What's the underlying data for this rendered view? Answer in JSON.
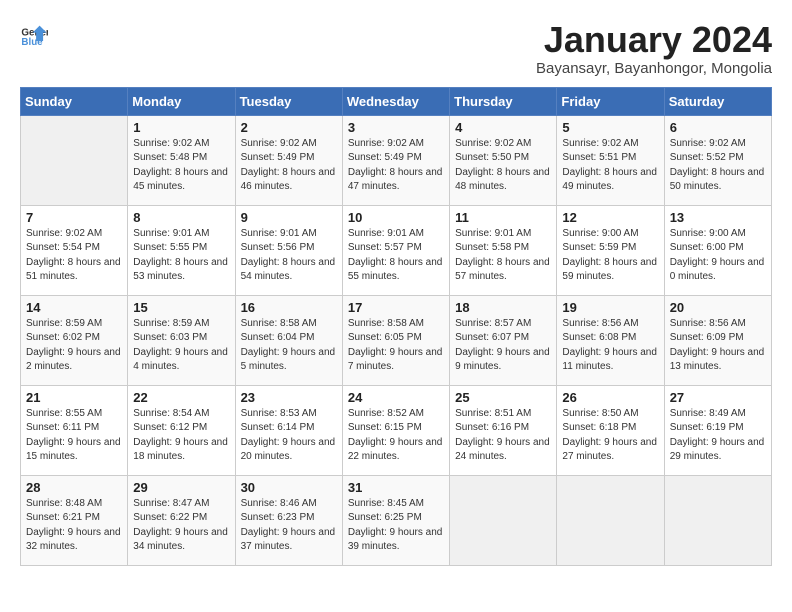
{
  "header": {
    "logo_general": "General",
    "logo_blue": "Blue",
    "month_title": "January 2024",
    "subtitle": "Bayansayr, Bayanhongor, Mongolia"
  },
  "weekdays": [
    "Sunday",
    "Monday",
    "Tuesday",
    "Wednesday",
    "Thursday",
    "Friday",
    "Saturday"
  ],
  "weeks": [
    [
      {
        "day": "",
        "sunrise": "",
        "sunset": "",
        "daylight": ""
      },
      {
        "day": "1",
        "sunrise": "9:02 AM",
        "sunset": "5:48 PM",
        "daylight": "8 hours and 45 minutes."
      },
      {
        "day": "2",
        "sunrise": "9:02 AM",
        "sunset": "5:49 PM",
        "daylight": "8 hours and 46 minutes."
      },
      {
        "day": "3",
        "sunrise": "9:02 AM",
        "sunset": "5:49 PM",
        "daylight": "8 hours and 47 minutes."
      },
      {
        "day": "4",
        "sunrise": "9:02 AM",
        "sunset": "5:50 PM",
        "daylight": "8 hours and 48 minutes."
      },
      {
        "day": "5",
        "sunrise": "9:02 AM",
        "sunset": "5:51 PM",
        "daylight": "8 hours and 49 minutes."
      },
      {
        "day": "6",
        "sunrise": "9:02 AM",
        "sunset": "5:52 PM",
        "daylight": "8 hours and 50 minutes."
      }
    ],
    [
      {
        "day": "7",
        "sunrise": "9:02 AM",
        "sunset": "5:54 PM",
        "daylight": "8 hours and 51 minutes."
      },
      {
        "day": "8",
        "sunrise": "9:01 AM",
        "sunset": "5:55 PM",
        "daylight": "8 hours and 53 minutes."
      },
      {
        "day": "9",
        "sunrise": "9:01 AM",
        "sunset": "5:56 PM",
        "daylight": "8 hours and 54 minutes."
      },
      {
        "day": "10",
        "sunrise": "9:01 AM",
        "sunset": "5:57 PM",
        "daylight": "8 hours and 55 minutes."
      },
      {
        "day": "11",
        "sunrise": "9:01 AM",
        "sunset": "5:58 PM",
        "daylight": "8 hours and 57 minutes."
      },
      {
        "day": "12",
        "sunrise": "9:00 AM",
        "sunset": "5:59 PM",
        "daylight": "8 hours and 59 minutes."
      },
      {
        "day": "13",
        "sunrise": "9:00 AM",
        "sunset": "6:00 PM",
        "daylight": "9 hours and 0 minutes."
      }
    ],
    [
      {
        "day": "14",
        "sunrise": "8:59 AM",
        "sunset": "6:02 PM",
        "daylight": "9 hours and 2 minutes."
      },
      {
        "day": "15",
        "sunrise": "8:59 AM",
        "sunset": "6:03 PM",
        "daylight": "9 hours and 4 minutes."
      },
      {
        "day": "16",
        "sunrise": "8:58 AM",
        "sunset": "6:04 PM",
        "daylight": "9 hours and 5 minutes."
      },
      {
        "day": "17",
        "sunrise": "8:58 AM",
        "sunset": "6:05 PM",
        "daylight": "9 hours and 7 minutes."
      },
      {
        "day": "18",
        "sunrise": "8:57 AM",
        "sunset": "6:07 PM",
        "daylight": "9 hours and 9 minutes."
      },
      {
        "day": "19",
        "sunrise": "8:56 AM",
        "sunset": "6:08 PM",
        "daylight": "9 hours and 11 minutes."
      },
      {
        "day": "20",
        "sunrise": "8:56 AM",
        "sunset": "6:09 PM",
        "daylight": "9 hours and 13 minutes."
      }
    ],
    [
      {
        "day": "21",
        "sunrise": "8:55 AM",
        "sunset": "6:11 PM",
        "daylight": "9 hours and 15 minutes."
      },
      {
        "day": "22",
        "sunrise": "8:54 AM",
        "sunset": "6:12 PM",
        "daylight": "9 hours and 18 minutes."
      },
      {
        "day": "23",
        "sunrise": "8:53 AM",
        "sunset": "6:14 PM",
        "daylight": "9 hours and 20 minutes."
      },
      {
        "day": "24",
        "sunrise": "8:52 AM",
        "sunset": "6:15 PM",
        "daylight": "9 hours and 22 minutes."
      },
      {
        "day": "25",
        "sunrise": "8:51 AM",
        "sunset": "6:16 PM",
        "daylight": "9 hours and 24 minutes."
      },
      {
        "day": "26",
        "sunrise": "8:50 AM",
        "sunset": "6:18 PM",
        "daylight": "9 hours and 27 minutes."
      },
      {
        "day": "27",
        "sunrise": "8:49 AM",
        "sunset": "6:19 PM",
        "daylight": "9 hours and 29 minutes."
      }
    ],
    [
      {
        "day": "28",
        "sunrise": "8:48 AM",
        "sunset": "6:21 PM",
        "daylight": "9 hours and 32 minutes."
      },
      {
        "day": "29",
        "sunrise": "8:47 AM",
        "sunset": "6:22 PM",
        "daylight": "9 hours and 34 minutes."
      },
      {
        "day": "30",
        "sunrise": "8:46 AM",
        "sunset": "6:23 PM",
        "daylight": "9 hours and 37 minutes."
      },
      {
        "day": "31",
        "sunrise": "8:45 AM",
        "sunset": "6:25 PM",
        "daylight": "9 hours and 39 minutes."
      },
      {
        "day": "",
        "sunrise": "",
        "sunset": "",
        "daylight": ""
      },
      {
        "day": "",
        "sunrise": "",
        "sunset": "",
        "daylight": ""
      },
      {
        "day": "",
        "sunrise": "",
        "sunset": "",
        "daylight": ""
      }
    ]
  ],
  "labels": {
    "sunrise_prefix": "Sunrise: ",
    "sunset_prefix": "Sunset: ",
    "daylight_prefix": "Daylight: "
  }
}
